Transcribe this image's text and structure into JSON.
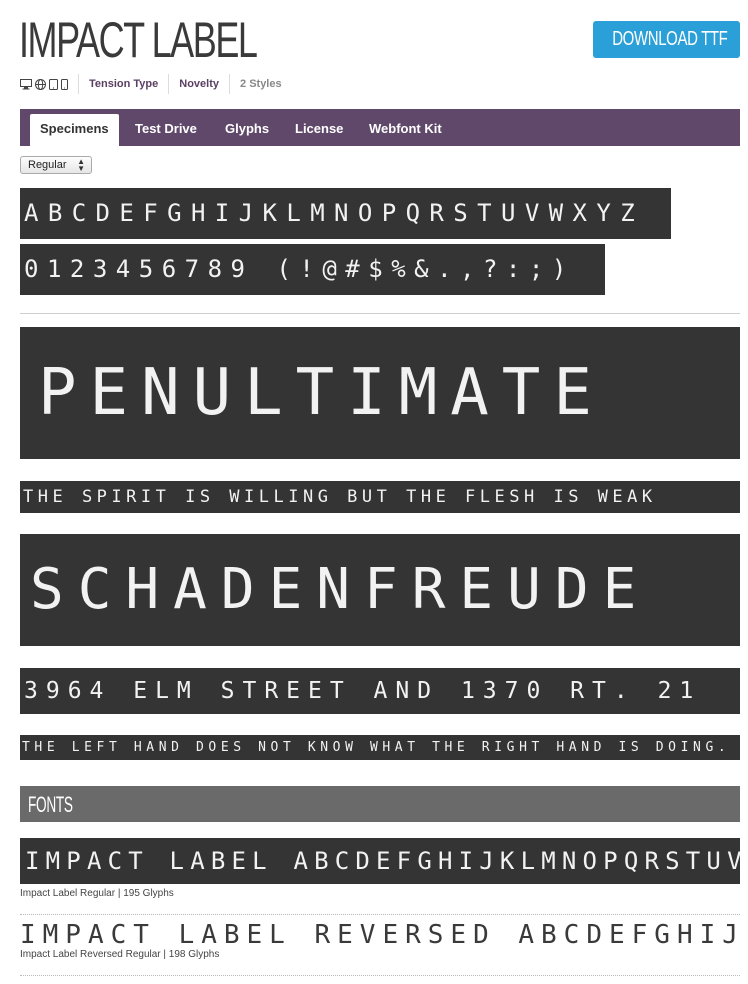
{
  "header": {
    "title": "IMPACT LABEL",
    "download_label": "DOWNLOAD TTF",
    "meta": {
      "device_icons": [
        "desktop-icon",
        "web-icon",
        "tablet-icon",
        "phone-icon"
      ],
      "foundry": "Tension Type",
      "category": "Novelty",
      "styles": "2 Styles"
    }
  },
  "tabs": [
    {
      "label": "Specimens",
      "active": true
    },
    {
      "label": "Test Drive",
      "active": false
    },
    {
      "label": "Glyphs",
      "active": false
    },
    {
      "label": "License",
      "active": false
    },
    {
      "label": "Webfont Kit",
      "active": false
    }
  ],
  "style_select": {
    "value": "Regular"
  },
  "specimens": {
    "alphabet": "ABCDEFGHIJKLMNOPQRSTUVWXYZ",
    "numerals": "0123456789 (!@#$%&.,?:;)",
    "words": [
      "PENULTIMATE",
      "THE SPIRIT IS WILLING BUT THE FLESH IS WEAK",
      "SCHADENFREUDE",
      "3964 ELM STREET AND 1370 RT. 21",
      "THE LEFT HAND DOES NOT KNOW WHAT THE RIGHT HAND IS DOING."
    ]
  },
  "fonts_section": {
    "title": "FONTS",
    "fonts": [
      {
        "sample": "IMPACT LABEL ABCDEFGHIJKLMNOPQRSTUVWXYZ",
        "caption": "Impact Label Regular | 195 Glyphs"
      },
      {
        "sample": "IMPACT LABEL REVERSED ABCDEFGHIJKLMNOP",
        "caption": "Impact Label Reversed Regular | 198 Glyphs"
      }
    ]
  },
  "colors": {
    "accent": "#60486b",
    "download": "#2a9fd8",
    "strip": "#343434",
    "header_bar": "#6a6a6a"
  }
}
